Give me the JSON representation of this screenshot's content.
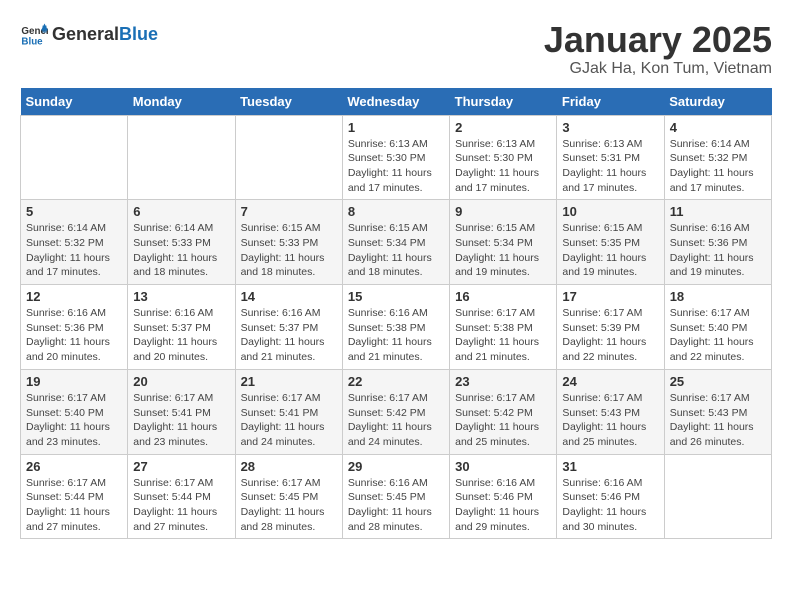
{
  "header": {
    "logo_general": "General",
    "logo_blue": "Blue",
    "title": "January 2025",
    "subtitle": "GJak Ha, Kon Tum, Vietnam"
  },
  "days_of_week": [
    "Sunday",
    "Monday",
    "Tuesday",
    "Wednesday",
    "Thursday",
    "Friday",
    "Saturday"
  ],
  "weeks": [
    [
      {
        "day": "",
        "info": ""
      },
      {
        "day": "",
        "info": ""
      },
      {
        "day": "",
        "info": ""
      },
      {
        "day": "1",
        "info": "Sunrise: 6:13 AM\nSunset: 5:30 PM\nDaylight: 11 hours and 17 minutes."
      },
      {
        "day": "2",
        "info": "Sunrise: 6:13 AM\nSunset: 5:30 PM\nDaylight: 11 hours and 17 minutes."
      },
      {
        "day": "3",
        "info": "Sunrise: 6:13 AM\nSunset: 5:31 PM\nDaylight: 11 hours and 17 minutes."
      },
      {
        "day": "4",
        "info": "Sunrise: 6:14 AM\nSunset: 5:32 PM\nDaylight: 11 hours and 17 minutes."
      }
    ],
    [
      {
        "day": "5",
        "info": "Sunrise: 6:14 AM\nSunset: 5:32 PM\nDaylight: 11 hours and 17 minutes."
      },
      {
        "day": "6",
        "info": "Sunrise: 6:14 AM\nSunset: 5:33 PM\nDaylight: 11 hours and 18 minutes."
      },
      {
        "day": "7",
        "info": "Sunrise: 6:15 AM\nSunset: 5:33 PM\nDaylight: 11 hours and 18 minutes."
      },
      {
        "day": "8",
        "info": "Sunrise: 6:15 AM\nSunset: 5:34 PM\nDaylight: 11 hours and 18 minutes."
      },
      {
        "day": "9",
        "info": "Sunrise: 6:15 AM\nSunset: 5:34 PM\nDaylight: 11 hours and 19 minutes."
      },
      {
        "day": "10",
        "info": "Sunrise: 6:15 AM\nSunset: 5:35 PM\nDaylight: 11 hours and 19 minutes."
      },
      {
        "day": "11",
        "info": "Sunrise: 6:16 AM\nSunset: 5:36 PM\nDaylight: 11 hours and 19 minutes."
      }
    ],
    [
      {
        "day": "12",
        "info": "Sunrise: 6:16 AM\nSunset: 5:36 PM\nDaylight: 11 hours and 20 minutes."
      },
      {
        "day": "13",
        "info": "Sunrise: 6:16 AM\nSunset: 5:37 PM\nDaylight: 11 hours and 20 minutes."
      },
      {
        "day": "14",
        "info": "Sunrise: 6:16 AM\nSunset: 5:37 PM\nDaylight: 11 hours and 21 minutes."
      },
      {
        "day": "15",
        "info": "Sunrise: 6:16 AM\nSunset: 5:38 PM\nDaylight: 11 hours and 21 minutes."
      },
      {
        "day": "16",
        "info": "Sunrise: 6:17 AM\nSunset: 5:38 PM\nDaylight: 11 hours and 21 minutes."
      },
      {
        "day": "17",
        "info": "Sunrise: 6:17 AM\nSunset: 5:39 PM\nDaylight: 11 hours and 22 minutes."
      },
      {
        "day": "18",
        "info": "Sunrise: 6:17 AM\nSunset: 5:40 PM\nDaylight: 11 hours and 22 minutes."
      }
    ],
    [
      {
        "day": "19",
        "info": "Sunrise: 6:17 AM\nSunset: 5:40 PM\nDaylight: 11 hours and 23 minutes."
      },
      {
        "day": "20",
        "info": "Sunrise: 6:17 AM\nSunset: 5:41 PM\nDaylight: 11 hours and 23 minutes."
      },
      {
        "day": "21",
        "info": "Sunrise: 6:17 AM\nSunset: 5:41 PM\nDaylight: 11 hours and 24 minutes."
      },
      {
        "day": "22",
        "info": "Sunrise: 6:17 AM\nSunset: 5:42 PM\nDaylight: 11 hours and 24 minutes."
      },
      {
        "day": "23",
        "info": "Sunrise: 6:17 AM\nSunset: 5:42 PM\nDaylight: 11 hours and 25 minutes."
      },
      {
        "day": "24",
        "info": "Sunrise: 6:17 AM\nSunset: 5:43 PM\nDaylight: 11 hours and 25 minutes."
      },
      {
        "day": "25",
        "info": "Sunrise: 6:17 AM\nSunset: 5:43 PM\nDaylight: 11 hours and 26 minutes."
      }
    ],
    [
      {
        "day": "26",
        "info": "Sunrise: 6:17 AM\nSunset: 5:44 PM\nDaylight: 11 hours and 27 minutes."
      },
      {
        "day": "27",
        "info": "Sunrise: 6:17 AM\nSunset: 5:44 PM\nDaylight: 11 hours and 27 minutes."
      },
      {
        "day": "28",
        "info": "Sunrise: 6:17 AM\nSunset: 5:45 PM\nDaylight: 11 hours and 28 minutes."
      },
      {
        "day": "29",
        "info": "Sunrise: 6:16 AM\nSunset: 5:45 PM\nDaylight: 11 hours and 28 minutes."
      },
      {
        "day": "30",
        "info": "Sunrise: 6:16 AM\nSunset: 5:46 PM\nDaylight: 11 hours and 29 minutes."
      },
      {
        "day": "31",
        "info": "Sunrise: 6:16 AM\nSunset: 5:46 PM\nDaylight: 11 hours and 30 minutes."
      },
      {
        "day": "",
        "info": ""
      }
    ]
  ]
}
